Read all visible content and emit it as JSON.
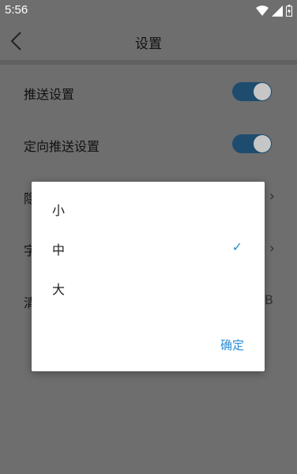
{
  "status_bar": {
    "time": "5:56"
  },
  "header": {
    "title": "设置"
  },
  "settings": {
    "rows": [
      {
        "label": "推送设置",
        "toggle_on": true
      },
      {
        "label": "定向推送设置",
        "toggle_on": true
      },
      {
        "label": "隐",
        "chevron": "›"
      },
      {
        "label": "字",
        "chevron": "›"
      },
      {
        "label": "清",
        "value": "B"
      }
    ]
  },
  "dialog": {
    "options": [
      {
        "label": "小",
        "selected": false
      },
      {
        "label": "中",
        "selected": true
      },
      {
        "label": "大",
        "selected": false
      }
    ],
    "check_mark": "✓",
    "confirm_label": "确定"
  },
  "colors": {
    "scrim": "#6e6e6e",
    "accent": "#2b8dd6",
    "toggle_track_dimmed": "#1e4c6e"
  }
}
